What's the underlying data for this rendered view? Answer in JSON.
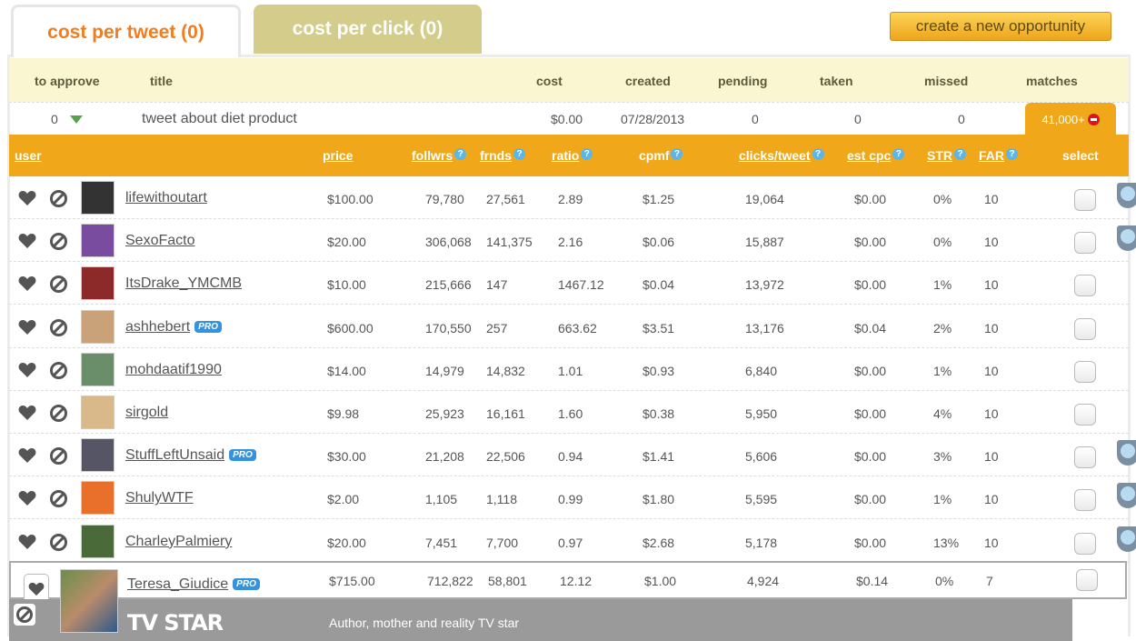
{
  "tabs": [
    {
      "label": "cost per tweet (0)"
    },
    {
      "label": "cost per click (0)"
    }
  ],
  "new_opportunity_label": "create a new opportunity",
  "opportunity_headers": {
    "to_approve": "to approve",
    "title": "title",
    "cost": "cost",
    "created": "created",
    "pending": "pending",
    "taken": "taken",
    "missed": "missed",
    "matches": "matches"
  },
  "opportunity": {
    "to_approve": "0",
    "title": "tweet about diet product",
    "cost": "$0.00",
    "created": "07/28/2013",
    "pending": "0",
    "taken": "0",
    "missed": "0",
    "matches": "41,000+"
  },
  "user_headers": {
    "user": "user",
    "price": "price",
    "follwrs": "follwrs",
    "frnds": "frnds",
    "ratio": "ratio",
    "cpmf": "cpmf",
    "clicks_tweet": "clicks/tweet",
    "est_cpc": "est cpc",
    "str": "STR",
    "far": "FAR",
    "select": "select",
    "help": "?"
  },
  "colors": {
    "accent": "#f37d1e",
    "header": "#f0a71a",
    "pro": "#3592dd"
  },
  "users": [
    {
      "name": "lifewithoutart",
      "pro": false,
      "price": "$100.00",
      "follwrs": "79,780",
      "frnds": "27,561",
      "ratio": "2.89",
      "cpmf": "$1.25",
      "clicks": "19,064",
      "cpc": "$0.00",
      "str": "0%",
      "far": "10",
      "shield": true
    },
    {
      "name": "SexoFacto",
      "pro": false,
      "price": "$20.00",
      "follwrs": "306,068",
      "frnds": "141,375",
      "ratio": "2.16",
      "cpmf": "$0.06",
      "clicks": "15,887",
      "cpc": "$0.00",
      "str": "0%",
      "far": "10",
      "shield": true
    },
    {
      "name": "ItsDrake_YMCMB",
      "pro": false,
      "price": "$10.00",
      "follwrs": "215,666",
      "frnds": "147",
      "ratio": "1467.12",
      "cpmf": "$0.04",
      "clicks": "13,972",
      "cpc": "$0.00",
      "str": "1%",
      "far": "10",
      "shield": false
    },
    {
      "name": "ashhebert",
      "pro": true,
      "price": "$600.00",
      "follwrs": "170,550",
      "frnds": "257",
      "ratio": "663.62",
      "cpmf": "$3.51",
      "clicks": "13,176",
      "cpc": "$0.04",
      "str": "2%",
      "far": "10",
      "shield": false
    },
    {
      "name": "mohdaatif1990",
      "pro": false,
      "price": "$14.00",
      "follwrs": "14,979",
      "frnds": "14,832",
      "ratio": "1.01",
      "cpmf": "$0.93",
      "clicks": "6,840",
      "cpc": "$0.00",
      "str": "1%",
      "far": "10",
      "shield": false
    },
    {
      "name": "sirgold",
      "pro": false,
      "price": "$9.98",
      "follwrs": "25,923",
      "frnds": "16,161",
      "ratio": "1.60",
      "cpmf": "$0.38",
      "clicks": "5,950",
      "cpc": "$0.00",
      "str": "4%",
      "far": "10",
      "shield": false
    },
    {
      "name": "StuffLeftUnsaid",
      "pro": true,
      "price": "$30.00",
      "follwrs": "21,208",
      "frnds": "22,506",
      "ratio": "0.94",
      "cpmf": "$1.41",
      "clicks": "5,606",
      "cpc": "$0.00",
      "str": "3%",
      "far": "10",
      "shield": true
    },
    {
      "name": "ShulyWTF",
      "pro": false,
      "price": "$2.00",
      "follwrs": "1,105",
      "frnds": "1,118",
      "ratio": "0.99",
      "cpmf": "$1.80",
      "clicks": "5,595",
      "cpc": "$0.00",
      "str": "1%",
      "far": "10",
      "shield": true
    },
    {
      "name": "CharleyPalmiery",
      "pro": false,
      "price": "$20.00",
      "follwrs": "7,451",
      "frnds": "7,700",
      "ratio": "0.97",
      "cpmf": "$2.68",
      "clicks": "5,178",
      "cpc": "$0.00",
      "str": "13%",
      "far": "10",
      "shield": true
    }
  ],
  "expanded_user": {
    "name": "Teresa_Giudice",
    "pro": true,
    "price": "$715.00",
    "follwrs": "712,822",
    "frnds": "58,801",
    "ratio": "12.12",
    "cpmf": "$1.00",
    "clicks": "4,924",
    "cpc": "$0.14",
    "str": "0%",
    "far": "7",
    "badge": "TV STAR",
    "bio": "Author, mother and reality TV star"
  },
  "pro_label": "PRO"
}
